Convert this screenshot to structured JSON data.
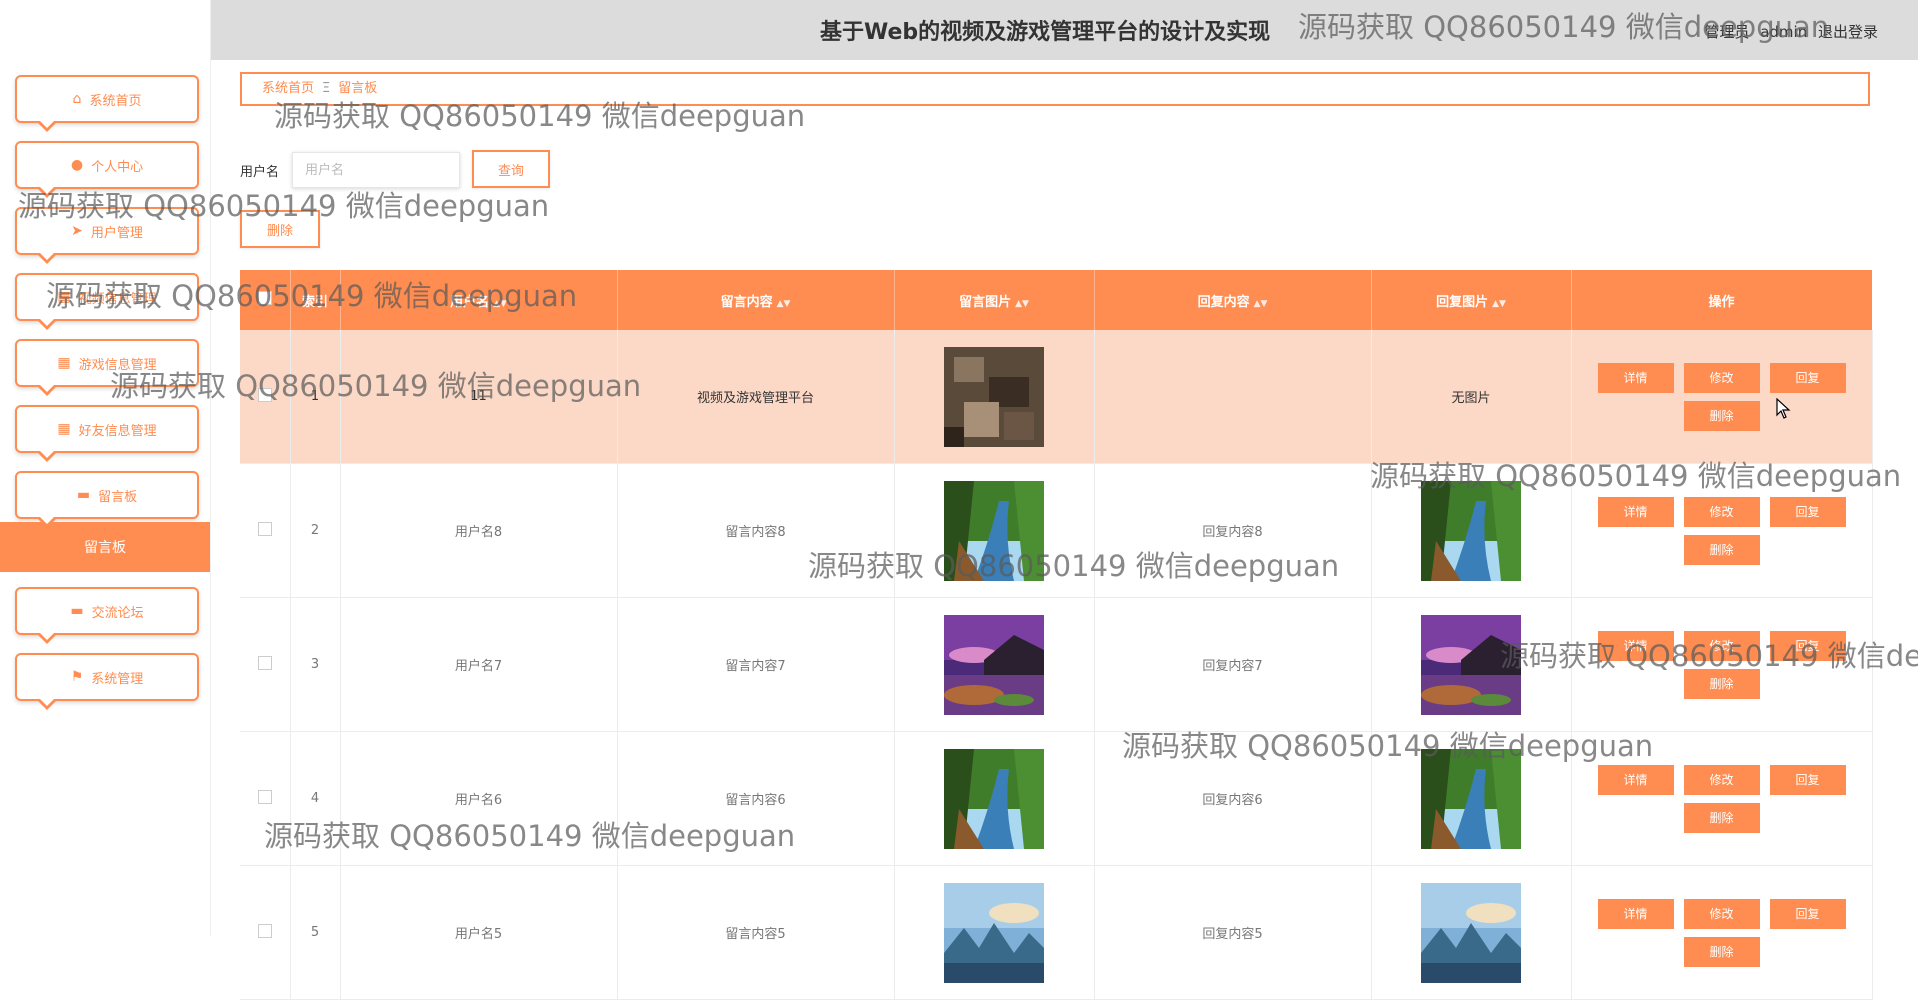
{
  "header": {
    "title": "基于Web的视频及游戏管理平台的设计及实现",
    "user_prefix": "管理员",
    "username": "admin",
    "logout": "退出登录"
  },
  "sidebar": {
    "items": [
      {
        "label": "系统首页",
        "icon": "home-icon"
      },
      {
        "label": "个人中心",
        "icon": "user-icon"
      },
      {
        "label": "用户管理",
        "icon": "send-icon"
      },
      {
        "label": "视频信息管理",
        "icon": "grid-icon"
      },
      {
        "label": "游戏信息管理",
        "icon": "grid-icon"
      },
      {
        "label": "好友信息管理",
        "icon": "grid-icon"
      },
      {
        "label": "留言板",
        "icon": "monitor-icon"
      }
    ],
    "active_label": "留言板",
    "bottom_items": [
      {
        "label": "交流论坛",
        "icon": "monitor-icon"
      },
      {
        "label": "系统管理",
        "icon": "flag-icon"
      }
    ]
  },
  "breadcrumb": {
    "home": "系统首页",
    "current": "留言板"
  },
  "search": {
    "label": "用户名",
    "placeholder": "用户名",
    "query_button": "查询"
  },
  "toolbar": {
    "delete_button": "删除"
  },
  "table": {
    "headers": [
      "索引",
      "用户名",
      "留言内容",
      "留言图片",
      "回复内容",
      "回复图片",
      "操作"
    ],
    "actions": [
      "详情",
      "修改",
      "回复",
      "删除"
    ],
    "no_image_text": "无图片",
    "rows": [
      {
        "index": "1",
        "username": "11",
        "message": "视频及游戏管理平台",
        "msg_img": "rock",
        "reply": "",
        "reply_img": ""
      },
      {
        "index": "2",
        "username": "用户名8",
        "message": "留言内容8",
        "msg_img": "forest",
        "reply": "回复内容8",
        "reply_img": "forest"
      },
      {
        "index": "3",
        "username": "用户名7",
        "message": "留言内容7",
        "msg_img": "sunset",
        "reply": "回复内容7",
        "reply_img": "sunset"
      },
      {
        "index": "4",
        "username": "用户名6",
        "message": "留言内容6",
        "msg_img": "forest",
        "reply": "回复内容6",
        "reply_img": "forest"
      },
      {
        "index": "5",
        "username": "用户名5",
        "message": "留言内容5",
        "msg_img": "mountain",
        "reply": "回复内容5",
        "reply_img": "mountain"
      }
    ]
  },
  "watermark": "源码获取 QQ86050149 微信deepguan",
  "colors": {
    "accent": "#ff8c50",
    "highlight_row": "#fcd9c7",
    "header_bg": "#dcdcdc"
  }
}
